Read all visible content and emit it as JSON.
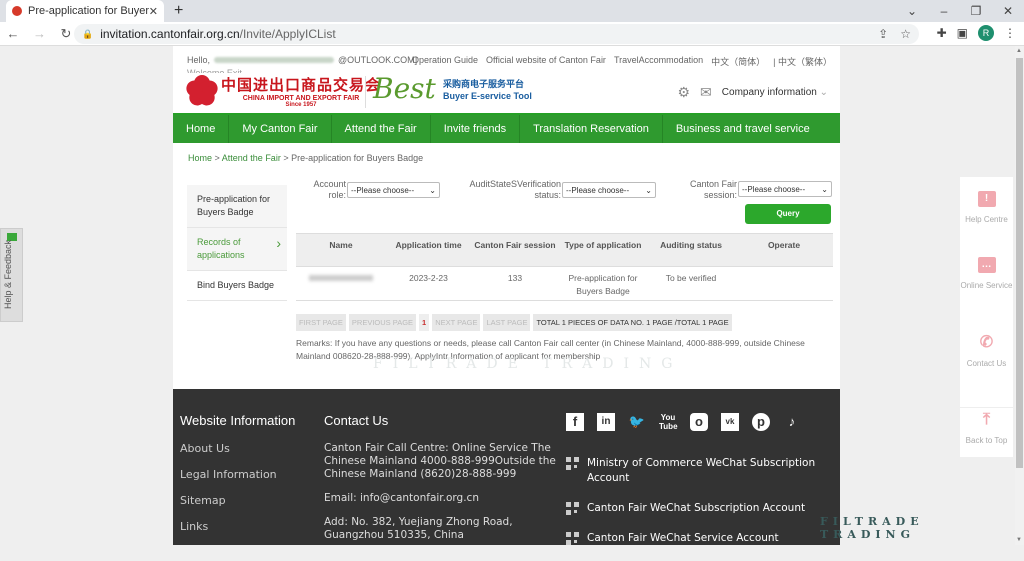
{
  "browser": {
    "tab_title": "Pre-application for Buyers Bad",
    "url_domain": "invitation.cantonfair.org.cn",
    "url_path": "/Invite/ApplyICList",
    "avatar_letter": "R"
  },
  "topbar": {
    "hello": "Hello,",
    "email_suffix": "@OUTLOOK.COM]",
    "welcome": "Welcome Exit",
    "links": [
      "Operation Guide",
      "Official website of Canton Fair",
      "TravelAccommodation",
      "中文（简体）",
      "| 中文（繁体）"
    ]
  },
  "logo": {
    "cn": "中国进出口商品交易会",
    "en": "CHINA IMPORT AND EXPORT FAIR",
    "since": "Since 1957",
    "best": "Best",
    "tool_cn": "采购商电子服务平台",
    "tool_en": "Buyer E-service Tool"
  },
  "header": {
    "company_info": "Company information"
  },
  "nav": [
    "Home",
    "My Canton Fair",
    "Attend the Fair",
    "Invite friends",
    "Translation Reservation",
    "Business and travel service"
  ],
  "breadcrumb": {
    "home": "Home",
    "sep": " > ",
    "attend": "Attend the Fair",
    "current": "Pre-application for Buyers Badge"
  },
  "sidebar": [
    {
      "label": "Pre-application for Buyers Badge"
    },
    {
      "label": "Records of applications"
    },
    {
      "label": "Bind Buyers Badge"
    }
  ],
  "filters": {
    "account_role_label": "Account role:",
    "account_role_value": "--Please choose--",
    "audit_label": "AuditStateSVerification status:",
    "audit_value": "--Please choose--",
    "session_label": "Canton Fair session:",
    "session_value": "--Please choose--",
    "query": "Query"
  },
  "table": {
    "headers": [
      "Name",
      "Application time",
      "Canton Fair session",
      "Type of application",
      "Auditing status",
      "Operate"
    ],
    "rows": [
      {
        "name": "",
        "time": "2023-2-23",
        "session": "133",
        "type": "Pre-application for Buyers Badge",
        "status": "To be verified",
        "operate": ""
      }
    ]
  },
  "pager": {
    "first": "FIRST PAGE",
    "prev": "PREVIOUS PAGE",
    "current": "1",
    "next": "NEXT PAGE",
    "last": "LAST PAGE",
    "total": "TOTAL 1 PIECES OF DATA NO. 1 PAGE /TOTAL 1 PAGE"
  },
  "remarks": "Remarks: If you have any questions or needs, please call Canton Fair call center (in Chinese Mainland, 4000-888-999, outside Chinese Mainland 008620-28-888-999). ApplyIntr Information of applicant for membership",
  "footer": {
    "website_info_title": "Website Information",
    "website_links": [
      "About Us",
      "Legal Information",
      "Sitemap",
      "Links"
    ],
    "contact_title": "Contact Us",
    "contact_call": "Canton Fair Call Centre: Online Service The Chinese Mainland 4000-888-999Outside the Chinese Mainland (8620)28-888-999",
    "contact_email": "Email: info@cantonfair.org.cn",
    "contact_address": "Add: No. 382, Yuejiang Zhong Road, Guangzhou 510335, China",
    "social": [
      "facebook",
      "linkedin",
      "twitter",
      "youtube",
      "instagram",
      "vk",
      "pinterest",
      "tiktok"
    ],
    "qr_items": [
      "Ministry of Commerce WeChat Subscription Account",
      "Canton Fair WeChat Subscription Account",
      "Canton Fair WeChat Service Account"
    ]
  },
  "feedback": "Help & Feedback",
  "right_panel": [
    "Help Centre",
    "Online Service",
    "Contact Us",
    "Back to Top"
  ],
  "watermark": "FILTRADE TRADING"
}
